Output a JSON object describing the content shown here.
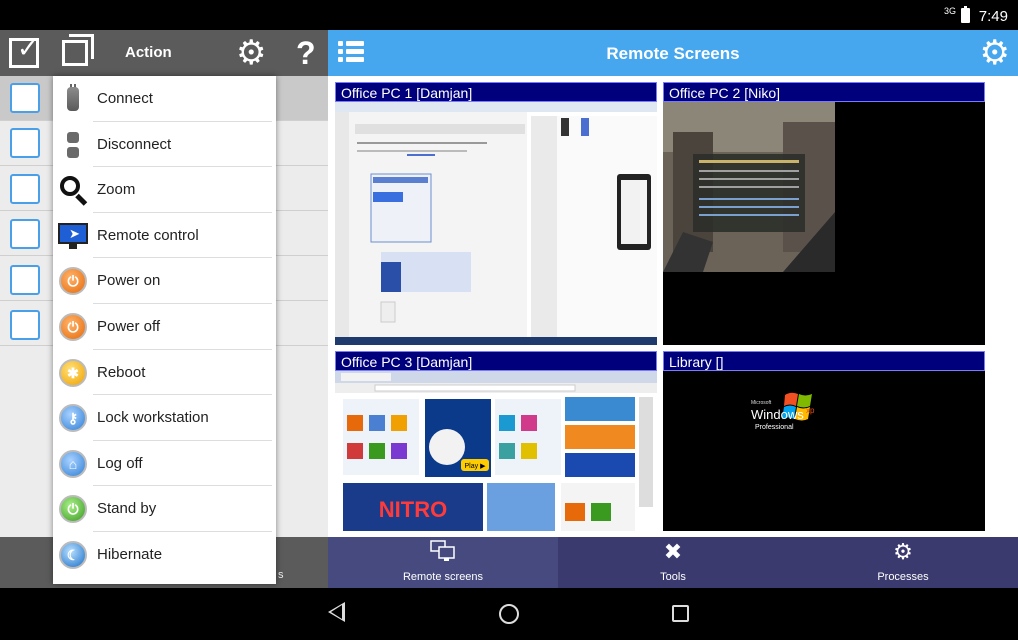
{
  "status_bar": {
    "signal": "3G",
    "time": "7:49"
  },
  "left_panel": {
    "title": "Action",
    "bottom_partial_text": "s",
    "row_count": 6
  },
  "action_menu": {
    "items": [
      {
        "label": "Connect",
        "icon": "plug-icon"
      },
      {
        "label": "Disconnect",
        "icon": "unplug-icon"
      },
      {
        "label": "Zoom",
        "icon": "magnifier-icon"
      },
      {
        "label": "Remote control",
        "icon": "monitor-icon"
      },
      {
        "label": "Power on",
        "icon": "power-on-icon"
      },
      {
        "label": "Power off",
        "icon": "power-off-icon"
      },
      {
        "label": "Reboot",
        "icon": "reboot-icon"
      },
      {
        "label": "Lock workstation",
        "icon": "lock-icon"
      },
      {
        "label": "Log off",
        "icon": "log-off-icon"
      },
      {
        "label": "Stand by",
        "icon": "stand-by-icon"
      },
      {
        "label": "Hibernate",
        "icon": "hibernate-icon"
      }
    ]
  },
  "right_panel": {
    "title": "Remote Screens",
    "screens": [
      {
        "label": "Office PC 1 [Damjan]"
      },
      {
        "label": "Office PC 2 [Niko]"
      },
      {
        "label": "Office PC 3 [Damjan]"
      },
      {
        "label": "Library []"
      }
    ],
    "library_logo": {
      "brand": "Microsoft",
      "product": "Windows",
      "edition": "xp",
      "sub": "Professional"
    },
    "pc3_banner": "NITRO",
    "pc3_badge": "Play ▶"
  },
  "bottom_nav": {
    "tabs": [
      {
        "label": "Remote screens",
        "icon": "remote-screens-icon"
      },
      {
        "label": "Tools",
        "icon": "tools-icon"
      },
      {
        "label": "Processes",
        "icon": "processes-icon"
      }
    ]
  },
  "colors": {
    "left_header": "#5b5b5b",
    "right_header": "#46a7ef",
    "tile_header": "#00007c",
    "bottom_nav": "#3a3a6e"
  }
}
